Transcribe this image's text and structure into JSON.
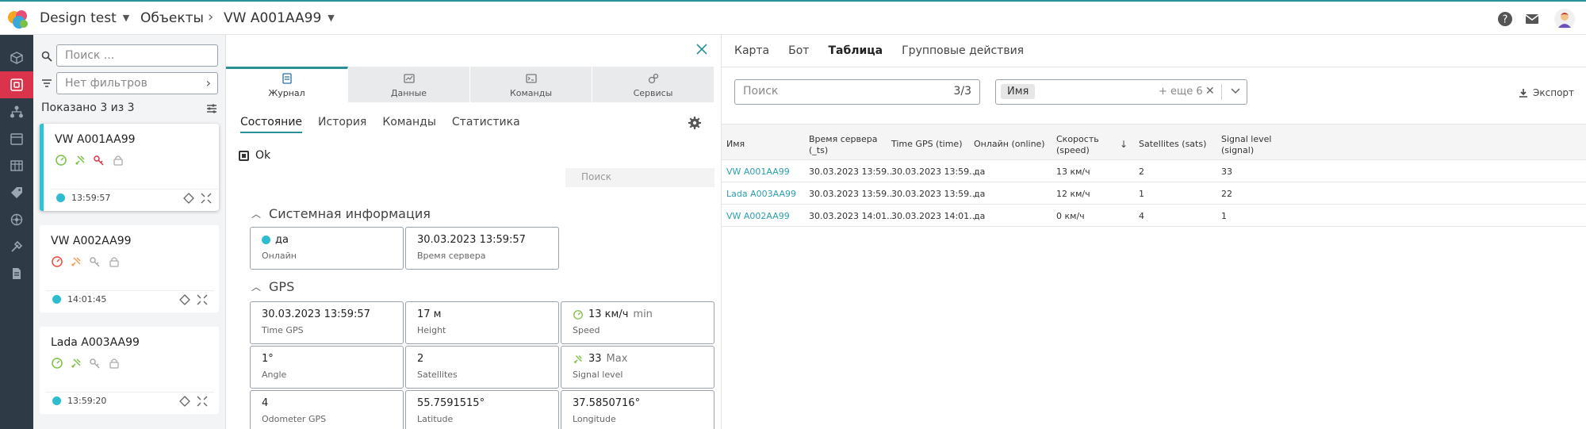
{
  "header": {
    "workspace": "Design test",
    "breadcrumb_objects": "Объекты",
    "breadcrumb_current": "VW A001AA99"
  },
  "colors": {
    "accent": "#2a8f98",
    "active_rail": "#d9344c",
    "online_dot": "#2fbcd0",
    "link": "#2a9fb0"
  },
  "list": {
    "search_placeholder": "Поиск ...",
    "filter_placeholder": "Нет фильтров",
    "shown": "Показано 3 из 3",
    "cards": [
      {
        "title": "VW A001AA99",
        "time": "13:59:57"
      },
      {
        "title": "VW A002AA99",
        "time": "14:01:45"
      },
      {
        "title": "Lada A003AA99",
        "time": "13:59:20"
      }
    ]
  },
  "mid": {
    "tabs": [
      {
        "label": "Журнал",
        "icon": "journal-icon"
      },
      {
        "label": "Данные",
        "icon": "data-icon"
      },
      {
        "label": "Команды",
        "icon": "commands-icon"
      },
      {
        "label": "Сервисы",
        "icon": "services-icon"
      }
    ],
    "subtabs": [
      "Состояние",
      "История",
      "Команды",
      "Статистика"
    ],
    "state": "Ok",
    "search_placeholder": "Поиск",
    "system_title": "Системная информация",
    "online_value": "да",
    "online_label": "Онлайн",
    "server_time_value": "30.03.2023 13:59:57",
    "server_time_label": "Время сервера",
    "gps_title": "GPS",
    "gps": {
      "time_gps_value": "30.03.2023 13:59:57",
      "time_gps_label": "Time GPS",
      "height_value": "17 м",
      "height_label": "Height",
      "speed_value": "13 км/ч",
      "speed_unit": "min",
      "speed_label": "Speed",
      "angle_value": "1°",
      "angle_label": "Angle",
      "satellites_value": "2",
      "satellites_label": "Satellites",
      "signal_value": "33",
      "signal_unit": "Max",
      "signal_label": "Signal level",
      "odometer_value": "4",
      "odometer_label": "Odometer GPS",
      "latitude_value": "55.7591515°",
      "latitude_label": "Latitude",
      "longitude_value": "37.5850716°",
      "longitude_label": "Longitude"
    }
  },
  "right": {
    "tabs": [
      "Карта",
      "Бот",
      "Таблица",
      "Групповые действия"
    ],
    "search_placeholder": "Поиск",
    "search_count": "3/3",
    "column_chip": "Имя",
    "column_more": "+ еще 6",
    "export": "Экспорт",
    "headers": {
      "name": "Имя",
      "server_time_1": "Время сервера",
      "server_time_2": "(_ts)",
      "gps_time": "Time GPS (time)",
      "online": "Онлайн (online)",
      "speed_1": "Скорость",
      "speed_2": "(speed)",
      "sort_arrow": "↓",
      "sats": "Satellites (sats)",
      "signal_1": "Signal level",
      "signal_2": "(signal)"
    },
    "rows": [
      {
        "name": "VW A001AA99",
        "server_time": "30.03.2023 13:59...",
        "gps_time": "30.03.2023 13:59...",
        "online": "да",
        "speed": "13 км/ч",
        "sats": "2",
        "signal": "33"
      },
      {
        "name": "Lada A003AA99",
        "server_time": "30.03.2023 13:59...",
        "gps_time": "30.03.2023 13:59...",
        "online": "да",
        "speed": "12 км/ч",
        "sats": "1",
        "signal": "22"
      },
      {
        "name": "VW A002AA99",
        "server_time": "30.03.2023 14:01...",
        "gps_time": "30.03.2023 14:01...",
        "online": "да",
        "speed": "0 км/ч",
        "sats": "4",
        "signal": "1"
      }
    ]
  }
}
